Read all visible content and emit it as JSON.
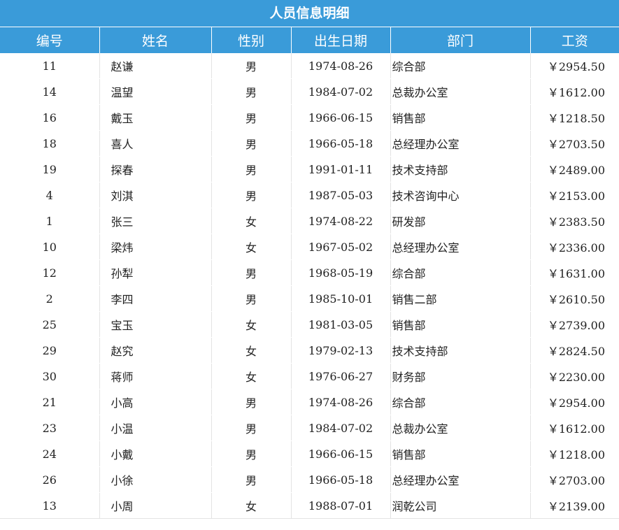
{
  "report": {
    "title": "人员信息明细",
    "columns": [
      "编号",
      "姓名",
      "性别",
      "出生日期",
      "部门",
      "工资"
    ],
    "rows": [
      {
        "id": "11",
        "name": "赵谦",
        "gender": "男",
        "birth": "1974-08-26",
        "dept": "综合部",
        "salary": "￥2954.50"
      },
      {
        "id": "14",
        "name": "温望",
        "gender": "男",
        "birth": "1984-07-02",
        "dept": "总裁办公室",
        "salary": "￥1612.00"
      },
      {
        "id": "16",
        "name": "戴玉",
        "gender": "男",
        "birth": "1966-06-15",
        "dept": "销售部",
        "salary": "￥1218.50"
      },
      {
        "id": "18",
        "name": "喜人",
        "gender": "男",
        "birth": "1966-05-18",
        "dept": "总经理办公室",
        "salary": "￥2703.50"
      },
      {
        "id": "19",
        "name": "探春",
        "gender": "男",
        "birth": "1991-01-11",
        "dept": "技术支持部",
        "salary": "￥2489.00"
      },
      {
        "id": "4",
        "name": "刘淇",
        "gender": "男",
        "birth": "1987-05-03",
        "dept": "技术咨询中心",
        "salary": "￥2153.00"
      },
      {
        "id": "1",
        "name": "张三",
        "gender": "女",
        "birth": "1974-08-22",
        "dept": "研发部",
        "salary": "￥2383.50"
      },
      {
        "id": "10",
        "name": "梁炜",
        "gender": "女",
        "birth": "1967-05-02",
        "dept": "总经理办公室",
        "salary": "￥2336.00"
      },
      {
        "id": "12",
        "name": "孙犁",
        "gender": "男",
        "birth": "1968-05-19",
        "dept": "综合部",
        "salary": "￥1631.00"
      },
      {
        "id": "2",
        "name": "李四",
        "gender": "男",
        "birth": "1985-10-01",
        "dept": "销售二部",
        "salary": "￥2610.50"
      },
      {
        "id": "25",
        "name": "宝玉",
        "gender": "女",
        "birth": "1981-03-05",
        "dept": "销售部",
        "salary": "￥2739.00"
      },
      {
        "id": "29",
        "name": "赵究",
        "gender": "女",
        "birth": "1979-02-13",
        "dept": "技术支持部",
        "salary": "￥2824.50"
      },
      {
        "id": "30",
        "name": "蒋师",
        "gender": "女",
        "birth": "1976-06-27",
        "dept": "财务部",
        "salary": "￥2230.00"
      },
      {
        "id": "21",
        "name": "小高",
        "gender": "男",
        "birth": "1974-08-26",
        "dept": "综合部",
        "salary": "￥2954.00"
      },
      {
        "id": "23",
        "name": "小温",
        "gender": "男",
        "birth": "1984-07-02",
        "dept": "总裁办公室",
        "salary": "￥1612.00"
      },
      {
        "id": "24",
        "name": "小戴",
        "gender": "男",
        "birth": "1966-06-15",
        "dept": "销售部",
        "salary": "￥1218.00"
      },
      {
        "id": "26",
        "name": "小徐",
        "gender": "男",
        "birth": "1966-05-18",
        "dept": "总经理办公室",
        "salary": "￥2703.00"
      },
      {
        "id": "13",
        "name": "小周",
        "gender": "女",
        "birth": "1988-07-01",
        "dept": "润乾公司",
        "salary": "￥2139.00"
      }
    ]
  },
  "colors": {
    "header_bg": "#3a9bd9",
    "header_text": "#ffffff",
    "grid_line": "#e3e3e3"
  }
}
